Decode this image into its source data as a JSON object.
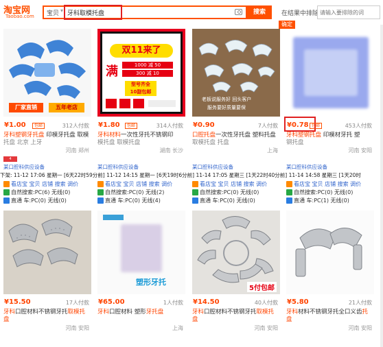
{
  "logo": {
    "main": "淘宝网",
    "sub": "Taobao.com"
  },
  "search": {
    "scope": "宝贝",
    "query": "牙科取模托盘",
    "button": "搜索"
  },
  "exclude": {
    "label": "在结果中排除",
    "placeholder": "请输入要排除的词",
    "confirm": "确定"
  },
  "row1": [
    {
      "price": "¥1.00",
      "tag": "包邮",
      "sales": "312人付款",
      "title_hl": "牙科塑钢牙托盘",
      "title_rest": " 印模牙托盘 取模",
      "title2": "托盘 北京 上牙",
      "location": "河南 郑州",
      "badge": "4年店铺",
      "overlay_left": "厂家直销",
      "overlay_right": "五年老店"
    },
    {
      "price": "¥1.80",
      "tag": "包邮",
      "sales": "314人付款",
      "title_hl": "牙科材料",
      "title_rest": "一次性牙托不锈钢印",
      "title2": "模托盘 取模托盘",
      "location": "湖南 长沙",
      "badge": "",
      "poster_big": "双11来了",
      "poster_full": "满",
      "poster_line1": "1000 减 50",
      "poster_line2": "300 减 10",
      "poster_bottom1": "型号齐全",
      "poster_bottom2": "10副包邮"
    },
    {
      "price": "¥0.90",
      "tag": "",
      "sales": "7人付款",
      "title_hl": "口腔托盘",
      "title_rest": "一次性牙托盘 塑料托盘",
      "title2": "取模托盘 托盘",
      "location": "上海",
      "badge": "",
      "overlay_text1": "老板说服务好 回头客户",
      "overlay_text2": "服务要好质量要保"
    },
    {
      "price": "¥0.78",
      "tag": "包邮",
      "sales": "453人付款",
      "title_hl": "牙科塑钢托盘",
      "title_rest": " 印模材牙托 塑",
      "title2": "钢托盘",
      "location": "河南 安阳",
      "badge": ""
    }
  ],
  "row1_shop": [
    {
      "shop": "某口腔科供应设备",
      "dates": "11-12 17:06 星期一",
      "r1": "看店宝 宝贝 店铺 搜索 调价",
      "r2": "自然搜索:PC(6) 无线(0)",
      "r3": "直通 车:PC(0) 无线(0)"
    },
    {
      "shop": "某口腔科供应设备",
      "dates": "11-12 14:15 星期一",
      "r1": "看店宝 宝贝 店铺 搜索 调价",
      "r2": "自然搜索:PC(0) 无线(2)",
      "r3": "直通 车:PC(0) 无线(4)"
    },
    {
      "shop": "某口腔科供应设备",
      "dates": "11-14 17:05 星期三",
      "r1": "看店宝 宝贝 店铺 搜索 调价",
      "r2": "自然搜索:PC(0) 无线(0)",
      "r3": "直通 车:PC(0) 无线(0)"
    },
    {
      "shop": "某口腔科供应设备",
      "dates": "11-14 14:58 星期三",
      "r1": "看店宝 宝贝 店铺 搜索 调价",
      "r2": "自然搜索:PC(0) 无线(0)",
      "r3": "直通 车:PC(1) 无线(0)"
    }
  ],
  "date_line": "下架: 11-12 17:06 星期一 [6天22时59分前] 11-12 14:15 星期一 [6天19时6分前] 11-14 17:05 星期三 [1天22时40分前] 11-14 14:58 星期三 [1天20时",
  "row2": [
    {
      "price": "¥15.50",
      "sales": "17人付款",
      "title_hl": "牙科",
      "title_rest": "口腔材料不锈钢牙托",
      "title_hl2": "取模托",
      "title2": "盘",
      "location": "河南 安阳"
    },
    {
      "price": "¥65.00",
      "sales": "1人付款",
      "title_hl": "牙科",
      "title_rest": "口腔材料 塑形",
      "title_hl2": "牙托盘",
      "title2": "",
      "location": "上海",
      "overlay": "塑形牙托"
    },
    {
      "price": "¥14.50",
      "sales": "40人付款",
      "title_hl": "牙科",
      "title_rest": "口腔材料不锈钢牙托",
      "title_hl2": "取模托",
      "title2": "盘",
      "location": "河南 安阳",
      "overlay": "5付包邮"
    },
    {
      "price": "¥5.80",
      "sales": "21人付款",
      "title_hl": "牙科",
      "title_rest": "材料不锈钢牙托全口义齿",
      "title_hl2": "托",
      "title2": "盘",
      "location": "河南 安阳"
    }
  ]
}
